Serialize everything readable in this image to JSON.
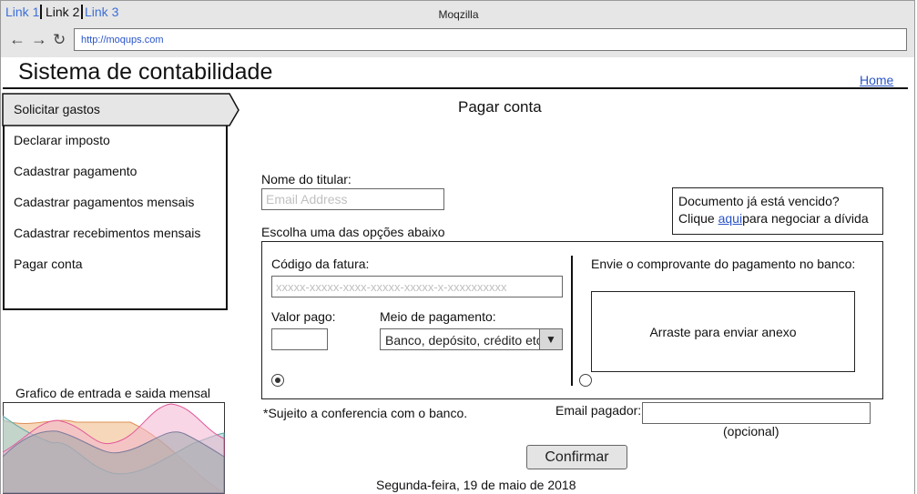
{
  "browser": {
    "tabs": [
      "Link 1",
      "Link 2",
      "Link 3"
    ],
    "window_title": "Moqzilla",
    "url": "http://moqups.com"
  },
  "header": {
    "app_title": "Sistema de contabilidade",
    "home_link": "Home"
  },
  "sidebar": {
    "items": [
      {
        "label": "Solicitar gastos"
      },
      {
        "label": "Declarar imposto"
      },
      {
        "label": "Cadastrar pagamento"
      },
      {
        "label": "Cadastrar pagamentos mensais"
      },
      {
        "label": "Cadastrar recebimentos mensais"
      },
      {
        "label": "Pagar conta"
      }
    ],
    "chart_title": "Grafico de entrada e saida mensal"
  },
  "main": {
    "heading": "Pagar conta",
    "holder_label": "Nome do titular:",
    "holder_placeholder": "Email Address",
    "overdue_line1": "Documento já está vencido?",
    "overdue_prefix": "Clique ",
    "overdue_link": "aqui",
    "overdue_suffix": "para negociar a dívida",
    "options_label": "Escolha uma das opções abaixo",
    "invoice_label": "Código da fatura:",
    "invoice_placeholder": "xxxxx-xxxxx-xxxx-xxxxx-xxxxx-x-xxxxxxxxxx",
    "amount_label": "Valor pago:",
    "amount_value": "",
    "payment_method_label": "Meio de pagamento:",
    "payment_method_value": "Banco, depósito, crédito etc",
    "upload_label": "Envie o comprovante do pagamento no banco:",
    "upload_dropzone": "Arraste para enviar anexo",
    "note": "*Sujeito a conferencia com o banco.",
    "payer_email_label": "Email pagador:",
    "payer_email_value": "",
    "optional_note": "(opcional)",
    "confirm_button": "Confirmar",
    "date": "Segunda-feira, 19 de maio de 2018"
  },
  "option_left_selected": true,
  "option_right_selected": false
}
